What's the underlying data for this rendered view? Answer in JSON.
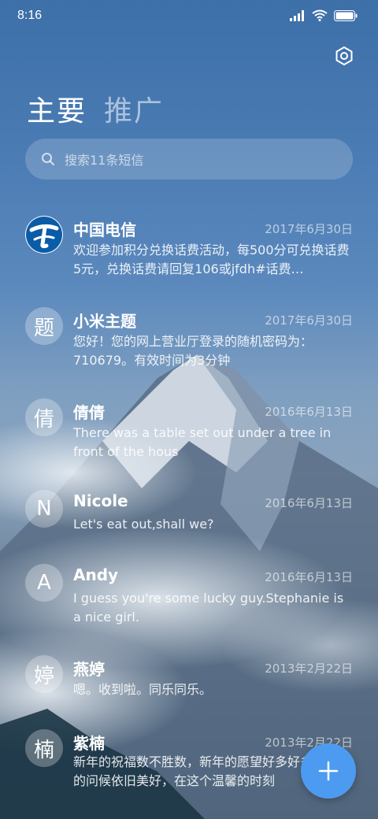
{
  "status_bar": {
    "time": "8:16"
  },
  "tabs": [
    {
      "label": "主要",
      "active": true
    },
    {
      "label": "推广",
      "active": false
    }
  ],
  "search": {
    "placeholder": "搜索11条短信"
  },
  "conversations": [
    {
      "avatar": "中国电信 logo",
      "name": "中国电信",
      "date": "2017年6月30日",
      "preview": "欢迎参加积分兑换话费活动，每500分可兑换话费5元，兑换话费请回复106或jfdh#话费…"
    },
    {
      "avatar": "题",
      "name": "小米主题",
      "date": "2017年6月30日",
      "preview": "您好！您的网上营业厅登录的随机密码为：710679。有效时间为3分钟"
    },
    {
      "avatar": "倩",
      "name": "倩倩",
      "date": "2016年6月13日",
      "preview": "There was a table set out under a tree in front of the hous"
    },
    {
      "avatar": "N",
      "name": "Nicole",
      "date": "2016年6月13日",
      "preview": "Let's eat out,shall we?"
    },
    {
      "avatar": "A",
      "name": "Andy",
      "date": "2016年6月13日",
      "preview": "I guess you're some lucky guy.Stephanie is a nice girl."
    },
    {
      "avatar": "婷",
      "name": "燕婷",
      "date": "2013年2月22日",
      "preview": "嗯。收到啦。同乐同乐。"
    },
    {
      "avatar": "楠",
      "name": "紫楠",
      "date": "2013年2月22日",
      "preview": "新年的祝福数不胜数，新年的愿望好多好多，新年的问候依旧美好，在这个温馨的时刻"
    }
  ],
  "fab": {
    "icon": "plus-icon"
  },
  "colors": {
    "accent": "#4d9bf0",
    "brand_telecom": "#0a5ca8"
  }
}
